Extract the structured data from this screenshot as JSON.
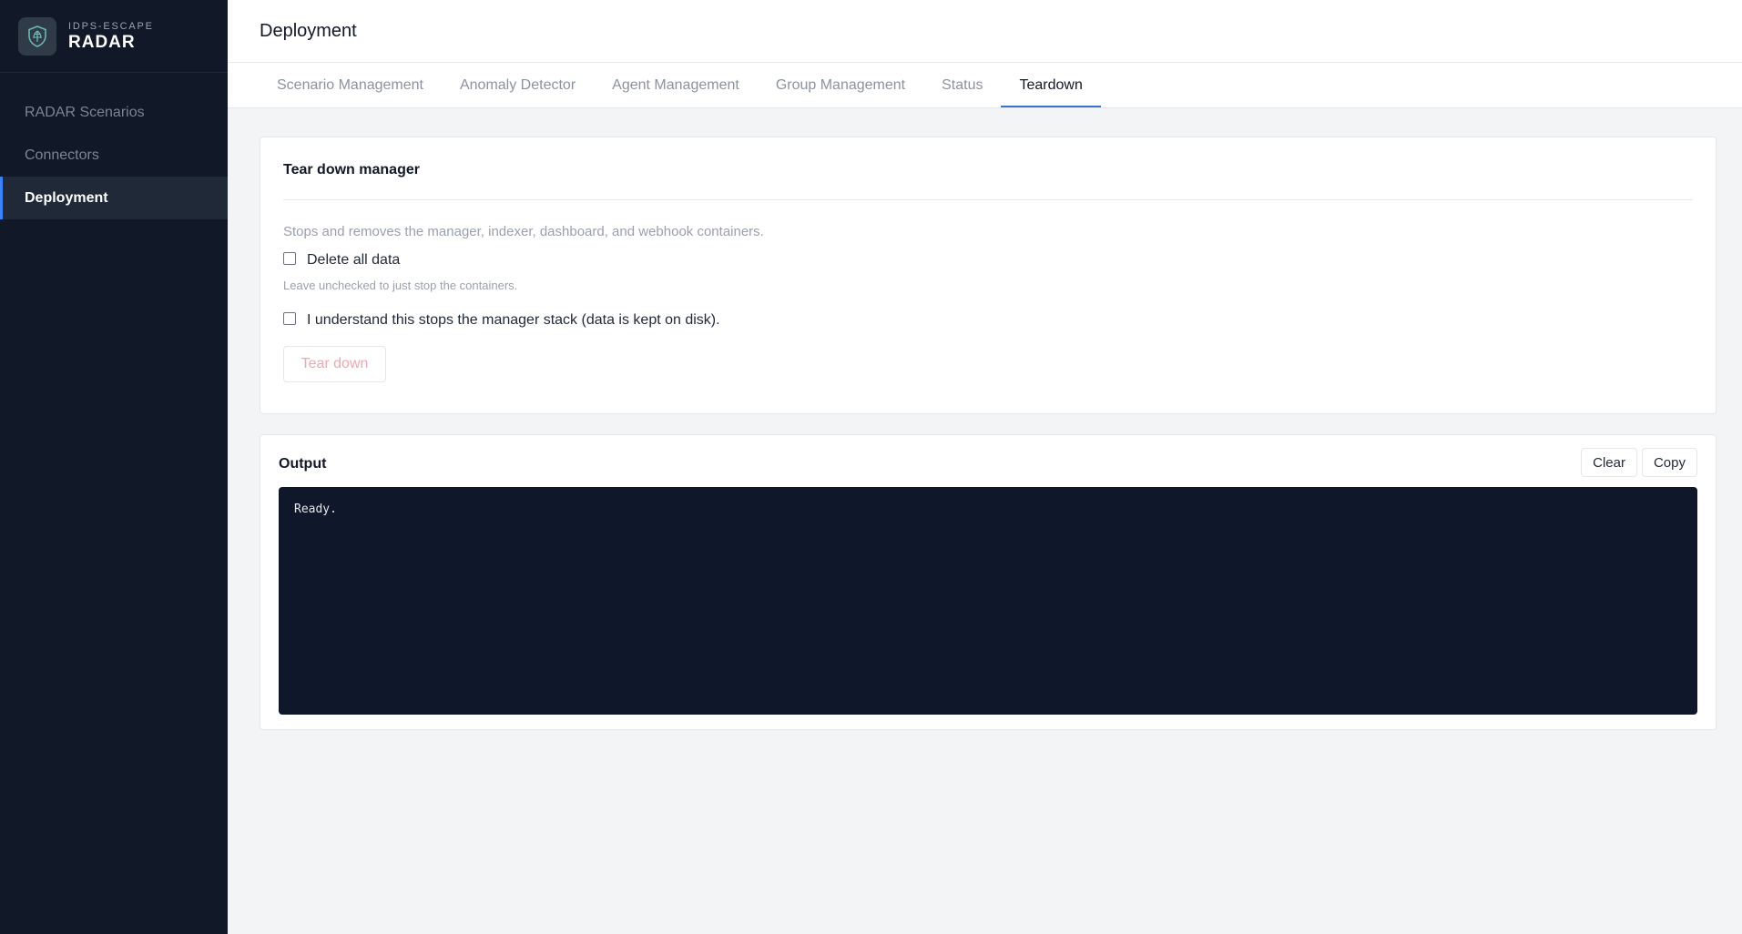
{
  "brand": {
    "subtitle": "IDPS-ESCAPE",
    "title": "RADAR",
    "logo_icon": "shield-icon"
  },
  "sidebar": {
    "items": [
      {
        "label": "RADAR Scenarios",
        "active": false
      },
      {
        "label": "Connectors",
        "active": false
      },
      {
        "label": "Deployment",
        "active": true
      }
    ]
  },
  "header": {
    "title": "Deployment"
  },
  "tabs": [
    {
      "label": "Scenario Management",
      "active": false
    },
    {
      "label": "Anomaly Detector",
      "active": false
    },
    {
      "label": "Agent Management",
      "active": false
    },
    {
      "label": "Group Management",
      "active": false
    },
    {
      "label": "Status",
      "active": false
    },
    {
      "label": "Teardown",
      "active": true
    }
  ],
  "teardown": {
    "title": "Tear down manager",
    "description": "Stops and removes the manager, indexer, dashboard, and webhook containers.",
    "delete_data_label": "Delete all data",
    "delete_data_checked": false,
    "delete_data_hint": "Leave unchecked to just stop the containers.",
    "confirm_label": "I understand this stops the manager stack (data is kept on disk).",
    "confirm_checked": false,
    "button_label": "Tear down"
  },
  "output": {
    "title": "Output",
    "clear_label": "Clear",
    "copy_label": "Copy",
    "text": "Ready."
  },
  "colors": {
    "sidebar_bg": "#111827",
    "accent": "#3b82f6",
    "console_bg": "#0f172a",
    "danger_disabled": "#f1a7ad"
  }
}
